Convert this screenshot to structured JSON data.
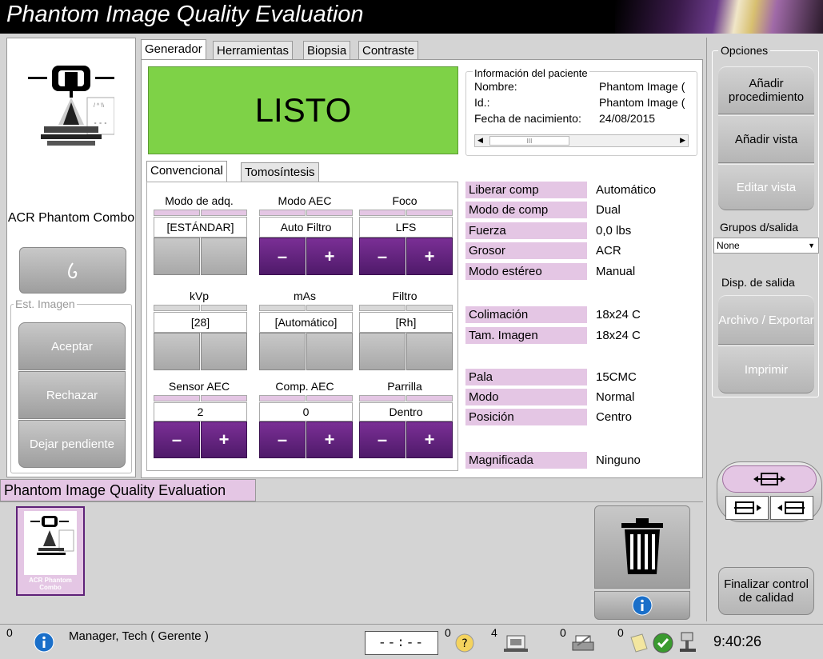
{
  "title": "Phantom Image Quality Evaluation",
  "left": {
    "procedure_name": "ACR Phantom Combo",
    "est_imagen_label": "Est. Imagen",
    "accept": "Aceptar",
    "reject": "Rechazar",
    "pending": "Dejar pendiente"
  },
  "tabs": [
    "Generador",
    "Herramientas",
    "Biopsia",
    "Contraste"
  ],
  "status": "LISTO",
  "patient": {
    "title": "Información del paciente",
    "name_label": "Nombre:",
    "name_value": "Phantom Image (",
    "id_label": "Id.:",
    "id_value": "Phantom Image (",
    "dob_label": "Fecha de nacimiento:",
    "dob_value": "24/08/2015",
    "scroll_mark": "III"
  },
  "subtabs": [
    "Convencional",
    "Tomosíntesis"
  ],
  "controls": {
    "acq_mode": {
      "label": "Modo de adq.",
      "value": "[ESTÁNDAR]"
    },
    "aec_mode": {
      "label": "Modo AEC",
      "value": "Auto Filtro"
    },
    "focus": {
      "label": "Foco",
      "value": "LFS"
    },
    "kvp": {
      "label": "kVp",
      "value": "[28]"
    },
    "mas": {
      "label": "mAs",
      "value": "[Automático]"
    },
    "filter": {
      "label": "Filtro",
      "value": "[Rh]"
    },
    "aec_sensor": {
      "label": "Sensor AEC",
      "value": "2"
    },
    "aec_comp": {
      "label": "Comp. AEC",
      "value": "0"
    },
    "grid": {
      "label": "Parrilla",
      "value": "Dentro"
    },
    "minus": "–",
    "plus": "+"
  },
  "params": [
    {
      "label": "Liberar comp",
      "value": "Automático"
    },
    {
      "label": "Modo de comp",
      "value": "Dual"
    },
    {
      "label": "Fuerza",
      "value": "0,0 lbs"
    },
    {
      "label": "Grosor",
      "value": "ACR"
    },
    {
      "label": "Modo estéreo",
      "value": "Manual"
    },
    {
      "label": "Colimación",
      "value": "18x24 C"
    },
    {
      "label": "Tam. Imagen",
      "value": "18x24 C"
    },
    {
      "label": "Pala",
      "value": "15CMC"
    },
    {
      "label": "Modo",
      "value": "Normal"
    },
    {
      "label": "Posición",
      "value": "Centro"
    },
    {
      "label": "Magnificada",
      "value": "Ninguno"
    }
  ],
  "right": {
    "options_label": "Opciones",
    "add_procedure": "Añadir procedimiento",
    "add_view": "Añadir vista",
    "edit_view": "Editar vista",
    "output_groups_label": "Grupos d/salida",
    "output_group_value": "None",
    "output_device_label": "Disp. de salida",
    "archive_export": "Archivo / Exportar",
    "print": "Imprimir",
    "finish_qc": "Finalizar control de calidad"
  },
  "bottom": {
    "procedure_tab": "Phantom Image Quality Evaluation",
    "thumb_label": "ACR Phantom Combo"
  },
  "statusbar": {
    "info_count": "0",
    "user": "Manager, Tech ( Gerente )",
    "timer": "--:--",
    "count1": "0",
    "count2": "4",
    "count3": "0",
    "count4": "0",
    "clock": "9:40:26"
  },
  "colors": {
    "accent_purple": "#e4c6e4",
    "button_purple": "#5e2178",
    "ready_green": "#7ed247"
  }
}
